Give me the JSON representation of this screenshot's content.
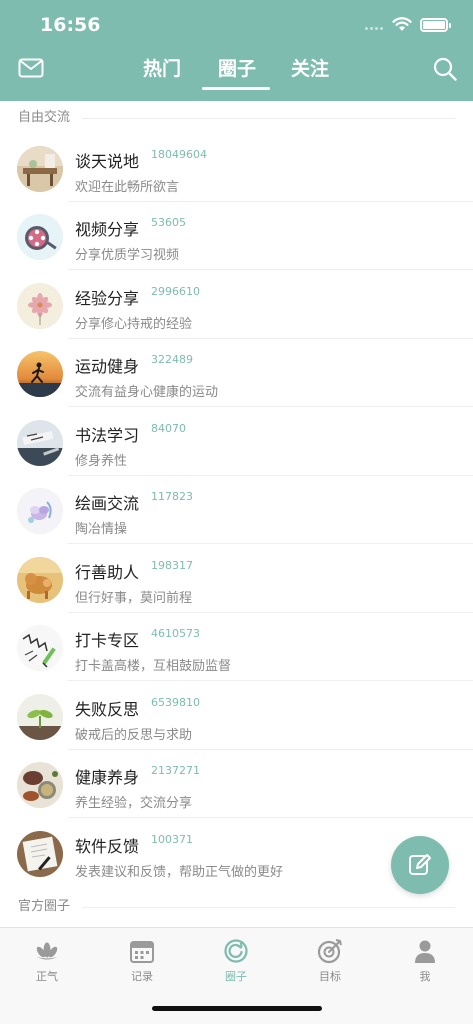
{
  "status_bar": {
    "time": "16:56"
  },
  "header": {
    "tabs": [
      {
        "label": "热门"
      },
      {
        "label": "圈子"
      },
      {
        "label": "关注"
      }
    ],
    "active_tab": "圈子",
    "accent_color": "#7dbcaf"
  },
  "sections": [
    {
      "title": "自由交流"
    },
    {
      "title": "官方圈子"
    }
  ],
  "circles": [
    {
      "name": "谈天说地",
      "count": "18049604",
      "desc": "欢迎在此畅所欲言"
    },
    {
      "name": "视频分享",
      "count": "53605",
      "desc": "分享优质学习视频"
    },
    {
      "name": "经验分享",
      "count": "2996610",
      "desc": "分享修心持戒的经验"
    },
    {
      "name": "运动健身",
      "count": "322489",
      "desc": "交流有益身心健康的运动"
    },
    {
      "name": "书法学习",
      "count": "84070",
      "desc": "修身养性"
    },
    {
      "name": "绘画交流",
      "count": "117823",
      "desc": "陶冶情操"
    },
    {
      "name": "行善助人",
      "count": "198317",
      "desc": "但行好事，莫问前程"
    },
    {
      "name": "打卡专区",
      "count": "4610573",
      "desc": "打卡盖高楼，互相鼓励监督"
    },
    {
      "name": "失败反思",
      "count": "6539810",
      "desc": "破戒后的反思与求助"
    },
    {
      "name": "健康养身",
      "count": "2137271",
      "desc": "养生经验，交流分享"
    },
    {
      "name": "软件反馈",
      "count": "100371",
      "desc": "发表建议和反馈，帮助正气做的更好"
    }
  ],
  "tabbar": {
    "items": [
      {
        "label": "正气",
        "icon": "lotus-icon"
      },
      {
        "label": "记录",
        "icon": "calendar-icon"
      },
      {
        "label": "圈子",
        "icon": "circle-refresh-icon"
      },
      {
        "label": "目标",
        "icon": "target-icon"
      },
      {
        "label": "我",
        "icon": "person-icon"
      }
    ],
    "active": "圈子"
  }
}
